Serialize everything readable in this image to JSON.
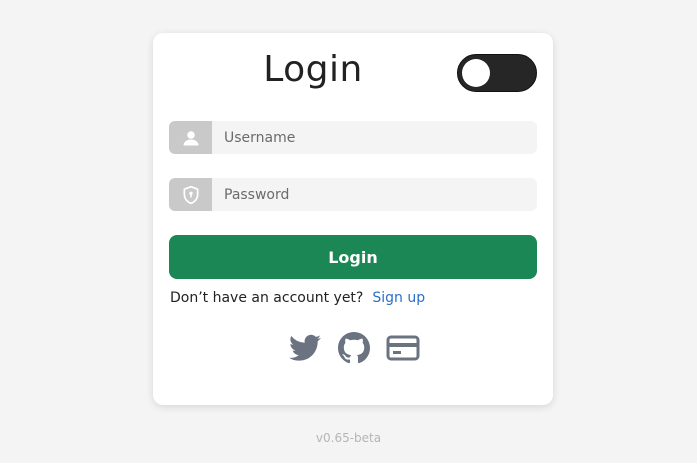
{
  "login": {
    "title": "Login",
    "username_placeholder": "Username",
    "password_placeholder": "Password",
    "button_label": "Login",
    "signup_prompt": "Don’t have an account yet?",
    "signup_link": "Sign up"
  },
  "toggle": {
    "state": "off"
  },
  "socials": [
    "twitter-icon",
    "github-icon",
    "credit-card-icon"
  ],
  "footer": {
    "version": "v0.65-beta"
  },
  "colors": {
    "accent": "#1b8755",
    "link": "#2a6fc9",
    "toggle_bg": "#262626",
    "addon_bg": "#c9c9c9",
    "icon": "#6b7280"
  }
}
